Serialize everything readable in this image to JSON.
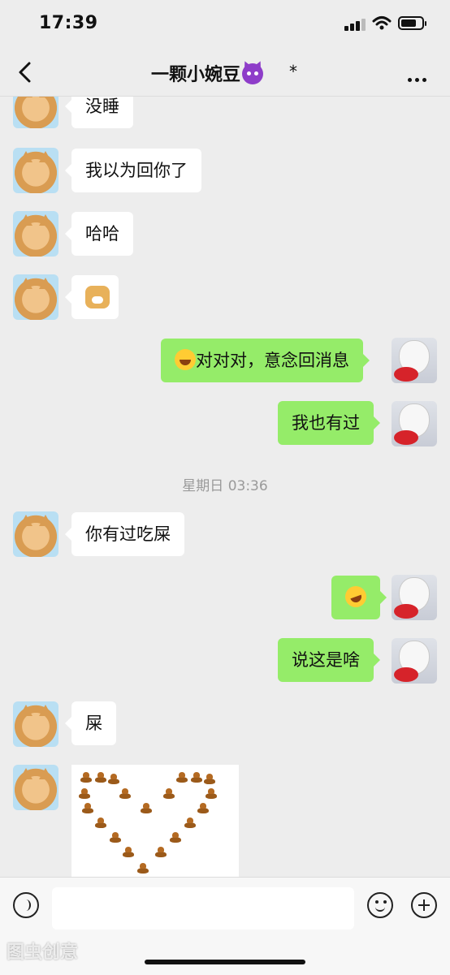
{
  "status": {
    "time": "17:39"
  },
  "header": {
    "title": "一颗小婉豆",
    "suffix": "*"
  },
  "messages": [
    {
      "side": "left",
      "text": "没睡"
    },
    {
      "side": "left",
      "text": "我以为回你了"
    },
    {
      "side": "left",
      "text": "哈哈"
    },
    {
      "side": "left",
      "text": "",
      "sticker": "doge"
    },
    {
      "side": "right",
      "text": "对对对，意念回消息",
      "sticker": "laughing-tears"
    },
    {
      "side": "right",
      "text": "我也有过"
    },
    {
      "side": "left",
      "text": "你有过吃屎"
    },
    {
      "side": "right",
      "text": "",
      "sticker": "rofl"
    },
    {
      "side": "right",
      "text": "说这是啥"
    },
    {
      "side": "left",
      "text": "屎"
    }
  ],
  "timestamp": "星期日 03:36",
  "watermark": "图虫创意",
  "colors": {
    "sent_bubble": "#95ec69",
    "received_bubble": "#ffffff",
    "background": "#ededed"
  }
}
